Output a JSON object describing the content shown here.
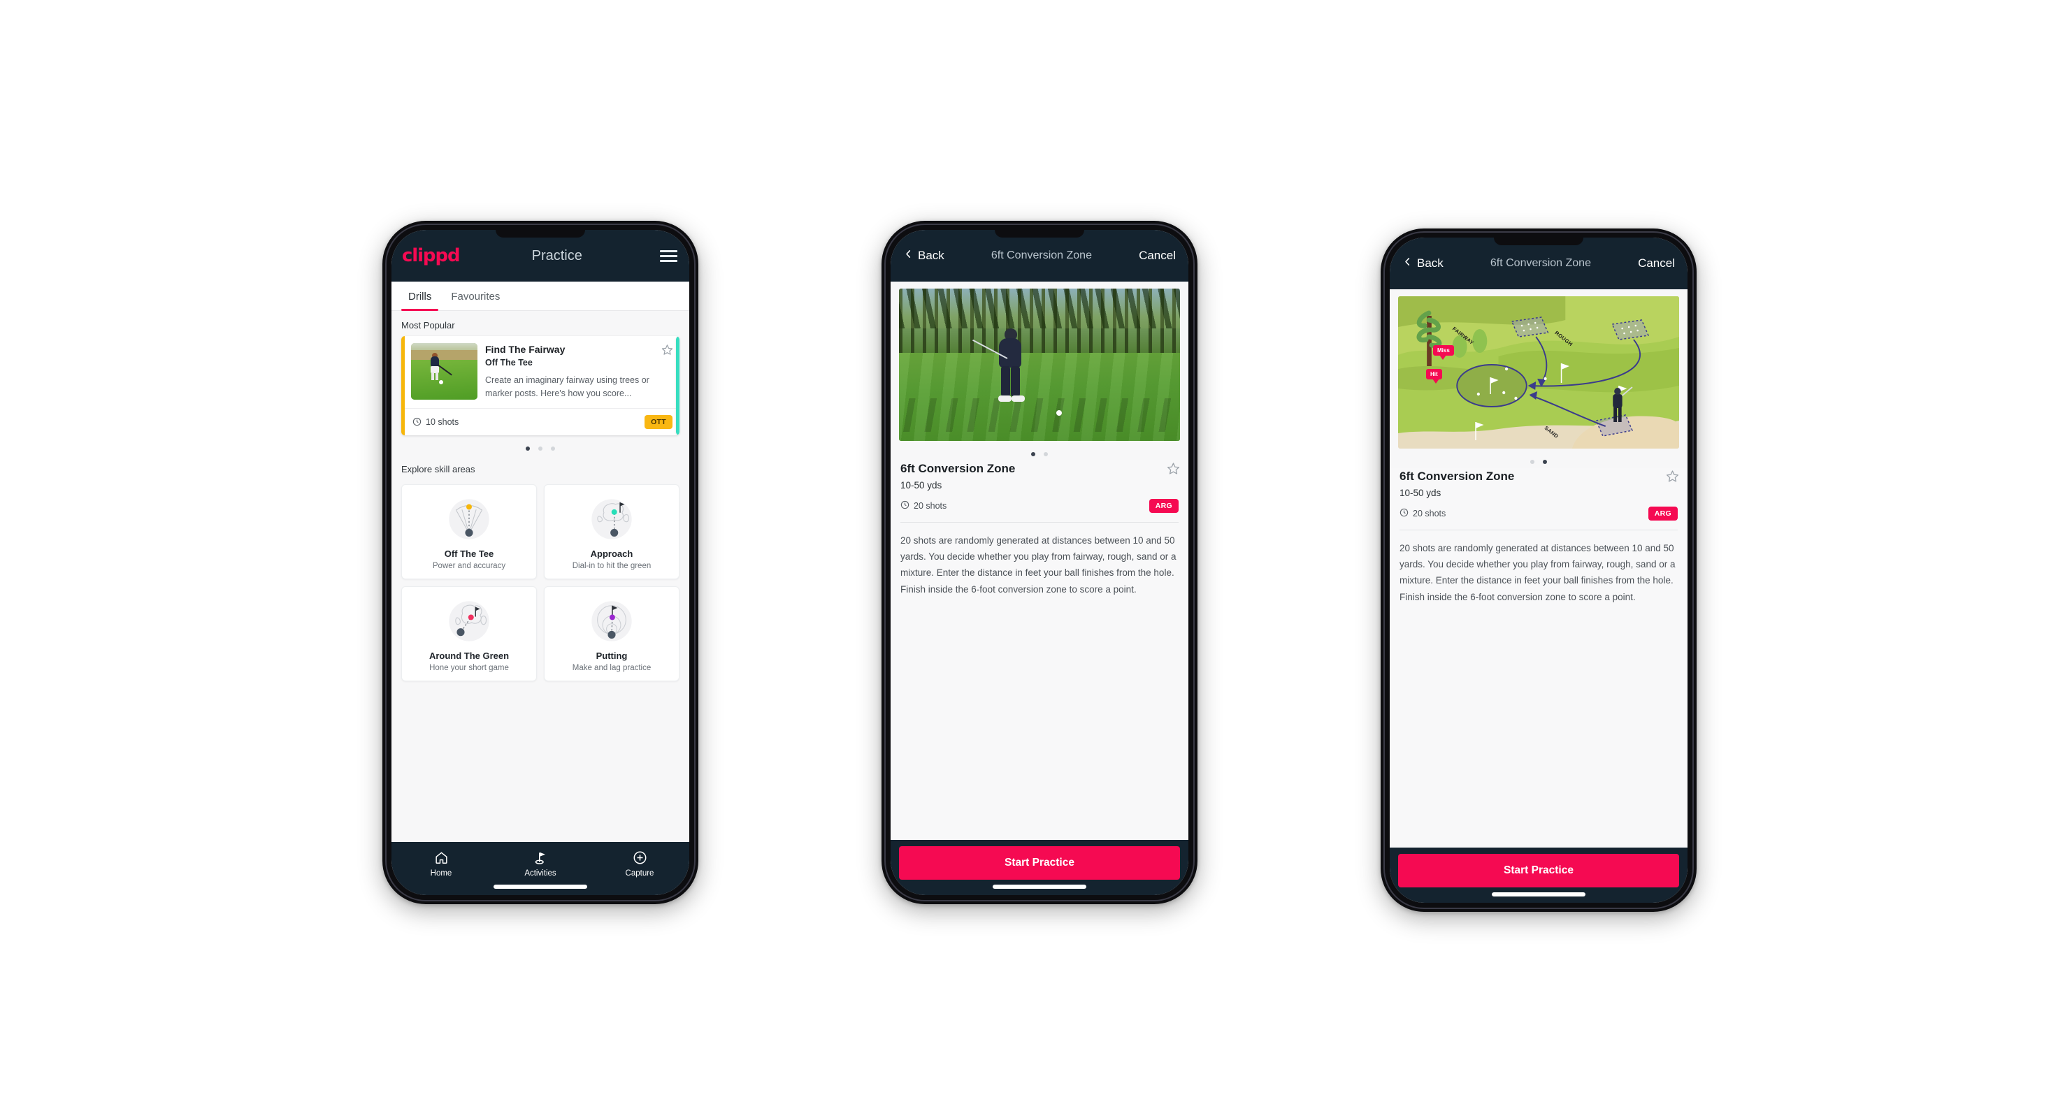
{
  "app": {
    "brand": "clippd",
    "accent": "#f50a52",
    "dark": "#14232f"
  },
  "phone1": {
    "header": {
      "logo": "clippd",
      "title": "Practice",
      "menu_icon": "hamburger-icon"
    },
    "tabs": [
      {
        "label": "Drills",
        "active": true
      },
      {
        "label": "Favourites",
        "active": false
      }
    ],
    "most_popular": {
      "section_title": "Most Popular",
      "card": {
        "title": "Find The Fairway",
        "subtitle": "Off The Tee",
        "description": "Create an imaginary fairway using trees or marker posts. Here's how you score...",
        "shots": "10 shots",
        "badge": "OTT",
        "badge_color": "#f9b713",
        "accent_color": "#f6b60a",
        "favourite_icon": "star-outline-icon",
        "clock_icon": "clock-icon"
      },
      "peek_accent_color": "#36dec0",
      "dots": {
        "count": 3,
        "active": 0
      }
    },
    "explore": {
      "section_title": "Explore skill areas",
      "cards": [
        {
          "name": "Off The Tee",
          "desc": "Power and accuracy",
          "icon": "tee-fan-icon",
          "dot_color": "#f6b60a"
        },
        {
          "name": "Approach",
          "desc": "Dial-in to hit the green",
          "icon": "approach-green-icon",
          "dot_color": "#27dfb8"
        },
        {
          "name": "Around The Green",
          "desc": "Hone your short game",
          "icon": "around-green-icon",
          "dot_color": "#f0305f"
        },
        {
          "name": "Putting",
          "desc": "Make and lag practice",
          "icon": "putting-rings-icon",
          "dot_color": "#9b28d0"
        }
      ]
    },
    "bottom_nav": [
      {
        "label": "Home",
        "icon": "home-icon",
        "active": false
      },
      {
        "label": "Activities",
        "icon": "golf-flag-icon",
        "active": true
      },
      {
        "label": "Capture",
        "icon": "plus-circle-icon",
        "active": false
      }
    ]
  },
  "phone2": {
    "nav": {
      "back_label": "Back",
      "back_icon": "chevron-left-icon",
      "title": "6ft Conversion Zone",
      "cancel_label": "Cancel"
    },
    "media": {
      "type": "photo",
      "alt": "golfer chipping on fairway"
    },
    "dots": {
      "count": 2,
      "active": 0
    },
    "detail": {
      "title": "6ft Conversion Zone",
      "yardage": "10-50 yds",
      "shots": "20 shots",
      "badge": "ARG",
      "badge_color": "#f50a52",
      "favourite_icon": "star-outline-icon",
      "clock_icon": "clock-icon",
      "description": "20 shots are randomly generated at distances between 10 and 50 yards. You decide whether you play from fairway, rough, sand or a mixture. Enter the distance in feet your ball finishes from the hole. Finish inside the 6-foot conversion zone to score a point."
    },
    "cta": {
      "label": "Start Practice"
    }
  },
  "phone3": {
    "nav": {
      "back_label": "Back",
      "back_icon": "chevron-left-icon",
      "title": "6ft Conversion Zone",
      "cancel_label": "Cancel"
    },
    "media": {
      "type": "illustration",
      "alt": "isometric golf hole diagram",
      "labels": [
        "FAIRWAY",
        "ROUGH",
        "SAND"
      ],
      "markers": [
        "Miss",
        "Hit"
      ]
    },
    "dots": {
      "count": 2,
      "active": 1
    },
    "detail": {
      "title": "6ft Conversion Zone",
      "yardage": "10-50 yds",
      "shots": "20 shots",
      "badge": "ARG",
      "badge_color": "#f50a52",
      "favourite_icon": "star-outline-icon",
      "clock_icon": "clock-icon",
      "description": "20 shots are randomly generated at distances between 10 and 50 yards. You decide whether you play from fairway, rough, sand or a mixture. Enter the distance in feet your ball finishes from the hole. Finish inside the 6-foot conversion zone to score a point."
    },
    "cta": {
      "label": "Start Practice"
    }
  }
}
